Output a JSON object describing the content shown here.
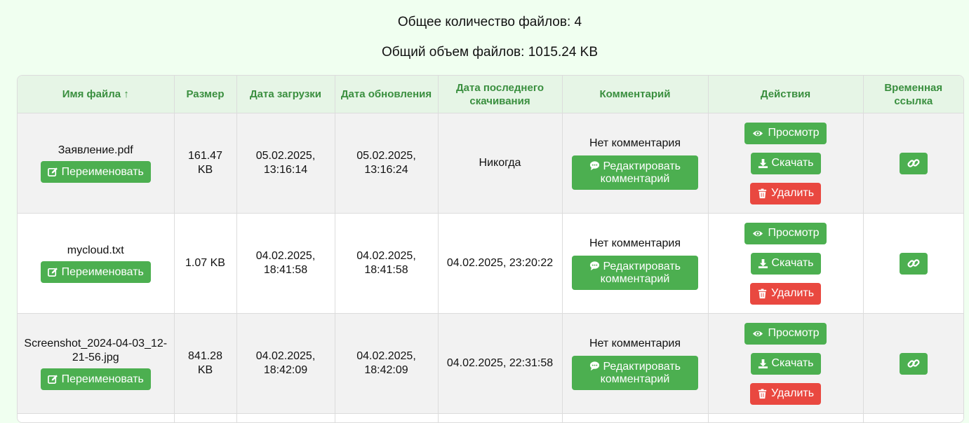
{
  "summary": {
    "count_text": "Общее количество файлов: 4",
    "size_text": "Общий объем файлов: 1015.24 KB"
  },
  "table": {
    "headers": {
      "name": "Имя файла",
      "size": "Размер",
      "upload": "Дата загрузки",
      "update": "Дата обновления",
      "download": "Дата последнего скачивания",
      "comment": "Комментарий",
      "actions": "Действия",
      "link": "Временная ссылка"
    },
    "sort_indicator": "↑",
    "rows": [
      {
        "filename": "Заявление.pdf",
        "size": "161.47 KB",
        "uploaded": "05.02.2025, 13:16:14",
        "updated": "05.02.2025, 13:16:24",
        "last_download": "Никогда",
        "comment": "Нет комментария"
      },
      {
        "filename": "mycloud.txt",
        "size": "1.07 KB",
        "uploaded": "04.02.2025, 18:41:58",
        "updated": "04.02.2025, 18:41:58",
        "last_download": "04.02.2025, 23:20:22",
        "comment": "Нет комментария"
      },
      {
        "filename": "Screenshot_2024-04-03_12-21-56.jpg",
        "size": "841.28 KB",
        "uploaded": "04.02.2025, 18:42:09",
        "updated": "04.02.2025, 18:42:09",
        "last_download": "04.02.2025, 22:31:58",
        "comment": "Нет комментария"
      }
    ]
  },
  "buttons": {
    "rename": "Переименовать",
    "edit_comment": "Редактировать комментарий",
    "view": "Просмотр",
    "download": "Скачать",
    "delete": "Удалить"
  },
  "icons": {
    "rename": "edit-icon",
    "edit_comment": "comment-icon",
    "view": "eye-icon",
    "download": "download-icon",
    "delete": "trash-icon",
    "link": "link-icon",
    "sort": "sort-arrow-up-icon"
  },
  "colors": {
    "page_bg": "#f0fff0",
    "header_bg": "#e6f5e6",
    "header_text": "#3a8f3f",
    "primary": "#4caf50",
    "danger": "#e94840"
  }
}
